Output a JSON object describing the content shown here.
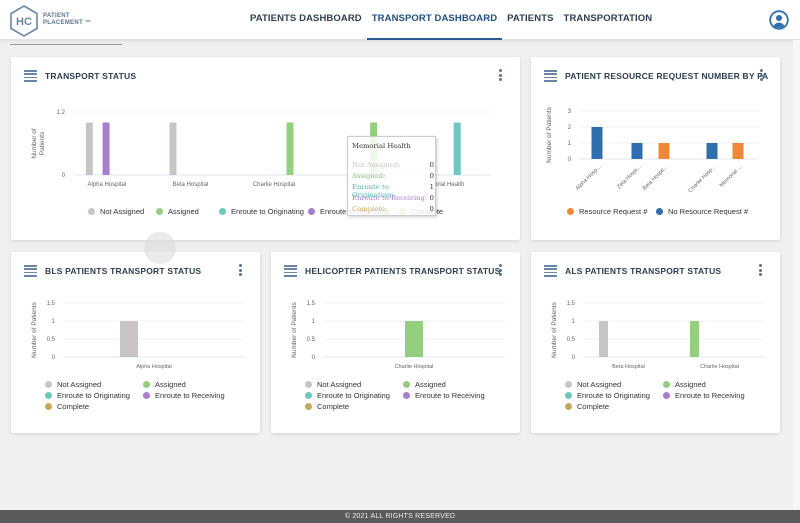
{
  "app": {
    "logo_initials": "HC",
    "logo_line1": "PATIENT",
    "logo_line2": "PLACEMENT ™"
  },
  "nav": {
    "items": [
      {
        "label": "PATIENTS DASHBOARD",
        "active": false
      },
      {
        "label": "TRANSPORT DASHBOARD",
        "active": true
      },
      {
        "label": "PATIENTS",
        "active": false
      },
      {
        "label": "TRANSPORTATION",
        "active": false
      }
    ],
    "user_icon": "user-circle-icon"
  },
  "colors": {
    "not_assigned": "#c9c4c4",
    "assigned": "#93cf7f",
    "enroute_originating": "#6fc8c0",
    "enroute_receiving": "#a77dce",
    "complete": "#c9a75a",
    "resource_request": "#f0883a",
    "no_resource_request": "#2f6fad"
  },
  "status_legend": [
    "Not Assigned",
    "Assigned",
    "Enroute to Originating",
    "Enroute to Receiving",
    "Complete"
  ],
  "tooltip": {
    "title": "Memorial Health",
    "rows": [
      {
        "label": "Not Assigned:",
        "value": "0"
      },
      {
        "label": "Assigned:",
        "value": "0"
      },
      {
        "label": "Enroute to Originating:",
        "value": "1"
      },
      {
        "label": "Enroute to Receiving:",
        "value": "0"
      },
      {
        "label": "Complete:",
        "value": "0"
      }
    ]
  },
  "footer": "© 2021 ALL RIGHTS RESERVED",
  "chart_data": [
    {
      "id": "transport-status",
      "title": "TRANSPORT STATUS",
      "type": "bar",
      "ylabel": "Number of Patients",
      "ylim": [
        0,
        1.2
      ],
      "yticks": [
        "0",
        "1.2"
      ],
      "categories": [
        "Alpha Hospital",
        "Beta Hospital",
        "Charlie Hospital",
        "",
        "Memorial Health"
      ],
      "visible_category_labels": [
        "Alpha Hospital",
        "Beta Hospital",
        "Charlie Hospital",
        "",
        "orial Health"
      ],
      "series": [
        {
          "name": "Not Assigned",
          "values": [
            1,
            1,
            0,
            0,
            0
          ]
        },
        {
          "name": "Assigned",
          "values": [
            0,
            0,
            1,
            1,
            0
          ]
        },
        {
          "name": "Enroute to Originating",
          "values": [
            0,
            0,
            0,
            0,
            1
          ]
        },
        {
          "name": "Enroute to Receiving",
          "values": [
            1,
            0,
            0,
            0,
            0
          ]
        },
        {
          "name": "Complete",
          "values": [
            0,
            0,
            0,
            0,
            0
          ]
        }
      ],
      "legend": "bottom"
    },
    {
      "id": "resource-request",
      "title": "PATIENT RESOURCE REQUEST NUMBER BY FA",
      "type": "bar",
      "ylabel": "Number of Patients",
      "ylim": [
        0,
        3
      ],
      "yticks": [
        "0",
        "1",
        "2",
        "3"
      ],
      "categories": [
        "Alpha Hosp...",
        "Zeta Hospi...",
        "Beta Hospit...",
        "Charlie Hosp...",
        "Memorial ..."
      ],
      "series": [
        {
          "name": "Resource Request #",
          "values": [
            0,
            0,
            1,
            0,
            1
          ]
        },
        {
          "name": "No Resource Request #",
          "values": [
            2,
            1,
            0,
            1,
            0
          ]
        }
      ],
      "legend": "bottom"
    },
    {
      "id": "bls",
      "title": "BLS PATIENTS TRANSPORT STATUS",
      "type": "bar",
      "ylabel": "Number of Patients",
      "ylim": [
        0,
        1.5
      ],
      "yticks": [
        "0",
        "0.5",
        "1",
        "1.5"
      ],
      "categories": [
        "Alpha Hospital"
      ],
      "series": [
        {
          "name": "Not Assigned",
          "values": [
            1
          ]
        },
        {
          "name": "Assigned",
          "values": [
            0
          ]
        },
        {
          "name": "Enroute to Originating",
          "values": [
            0
          ]
        },
        {
          "name": "Enroute to Receiving",
          "values": [
            0
          ]
        },
        {
          "name": "Complete",
          "values": [
            0
          ]
        }
      ],
      "legend": "bottom"
    },
    {
      "id": "helicopter",
      "title": "HELICOPTER PATIENTS TRANSPORT STATUS",
      "type": "bar",
      "ylabel": "Number of Patients",
      "ylim": [
        0,
        1.5
      ],
      "yticks": [
        "0",
        "0.5",
        "1",
        "1.5"
      ],
      "categories": [
        "Charlie Hospital"
      ],
      "series": [
        {
          "name": "Not Assigned",
          "values": [
            0
          ]
        },
        {
          "name": "Assigned",
          "values": [
            1
          ]
        },
        {
          "name": "Enroute to Originating",
          "values": [
            0
          ]
        },
        {
          "name": "Enroute to Receiving",
          "values": [
            0
          ]
        },
        {
          "name": "Complete",
          "values": [
            0
          ]
        }
      ],
      "legend": "bottom"
    },
    {
      "id": "als",
      "title": "ALS PATIENTS TRANSPORT STATUS",
      "type": "bar",
      "ylabel": "Number of Patients",
      "ylim": [
        0,
        1.5
      ],
      "yticks": [
        "0",
        "0.5",
        "1",
        "1.5"
      ],
      "categories": [
        "Beta Hospital",
        "Charlie Hospital"
      ],
      "series": [
        {
          "name": "Not Assigned",
          "values": [
            1,
            0
          ]
        },
        {
          "name": "Assigned",
          "values": [
            0,
            1
          ]
        },
        {
          "name": "Enroute to Originating",
          "values": [
            0,
            0
          ]
        },
        {
          "name": "Enroute to Receiving",
          "values": [
            0,
            0
          ]
        },
        {
          "name": "Complete",
          "values": [
            0,
            0
          ]
        }
      ],
      "legend": "bottom"
    }
  ]
}
